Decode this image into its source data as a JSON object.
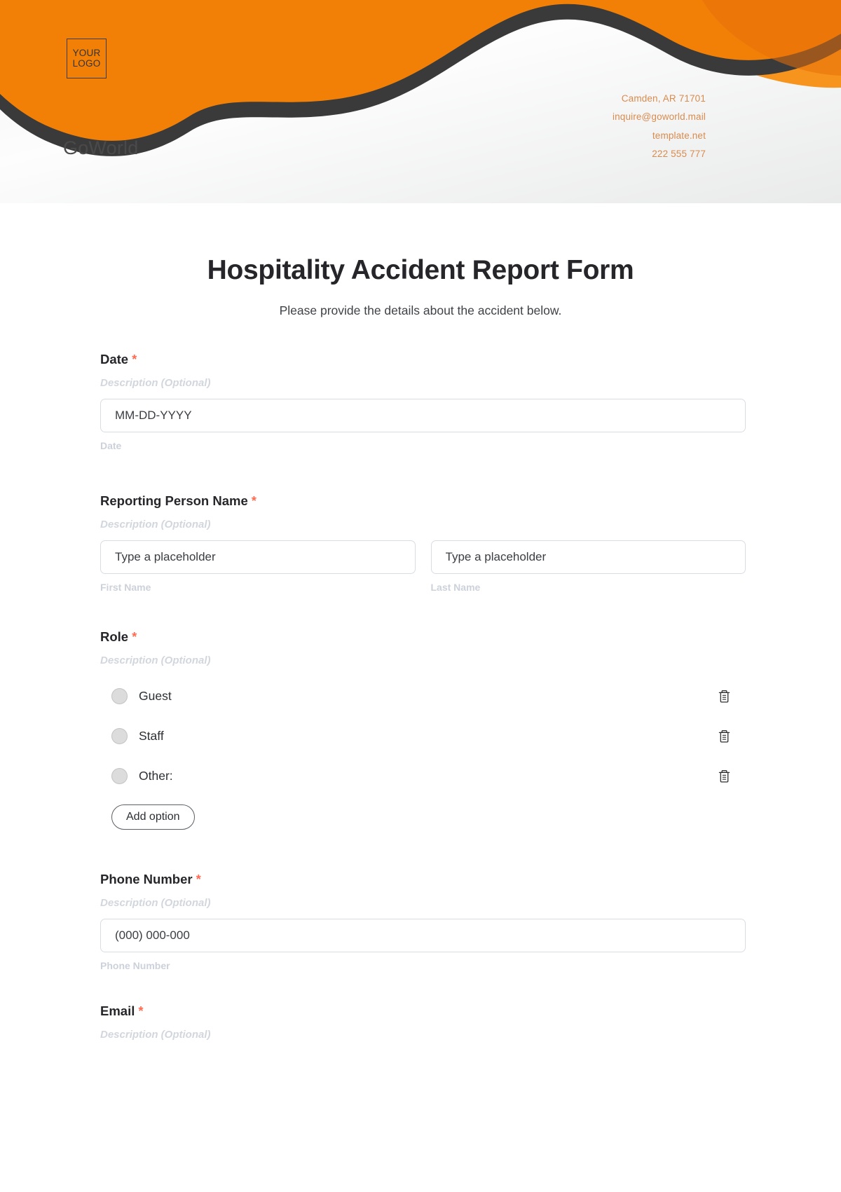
{
  "header": {
    "logo_line1": "YOUR",
    "logo_line2": "LOGO",
    "brand_name": "GoWorld",
    "contact": {
      "address": "Camden, AR 71701",
      "email": "inquire@goworld.mail",
      "website": "template.net",
      "phone": "222 555 777"
    },
    "colors": {
      "orange": "#F28007",
      "orange_light": "#F7941E",
      "dark": "#3A3A3A",
      "contact_text": "#D98B4E"
    }
  },
  "form": {
    "title": "Hospitality Accident Report Form",
    "subtitle": "Please provide the details about the accident below.",
    "required_marker": "*",
    "description_placeholder": "Description (Optional)",
    "add_option_label": "Add option",
    "fields": [
      {
        "label": "Date",
        "required": true,
        "description": "Description (Optional)",
        "placeholder": "MM-DD-YYYY",
        "sub_label": "Date"
      },
      {
        "label": "Reporting Person Name",
        "required": true,
        "description": "Description (Optional)",
        "first_placeholder": "Type a placeholder",
        "last_placeholder": "Type a placeholder",
        "first_sub_label": "First Name",
        "last_sub_label": "Last Name"
      },
      {
        "label": "Role",
        "required": true,
        "description": "Description (Optional)",
        "options": [
          {
            "label": "Guest",
            "delete_icon": "trash-icon"
          },
          {
            "label": "Staff",
            "delete_icon": "trash-icon"
          },
          {
            "label": "Other:",
            "delete_icon": "trash-icon"
          }
        ]
      },
      {
        "label": "Phone Number",
        "required": true,
        "description": "Description (Optional)",
        "placeholder": "(000) 000-000",
        "sub_label": "Phone Number"
      },
      {
        "label": "Email",
        "required": true,
        "description": "Description (Optional)"
      }
    ]
  }
}
